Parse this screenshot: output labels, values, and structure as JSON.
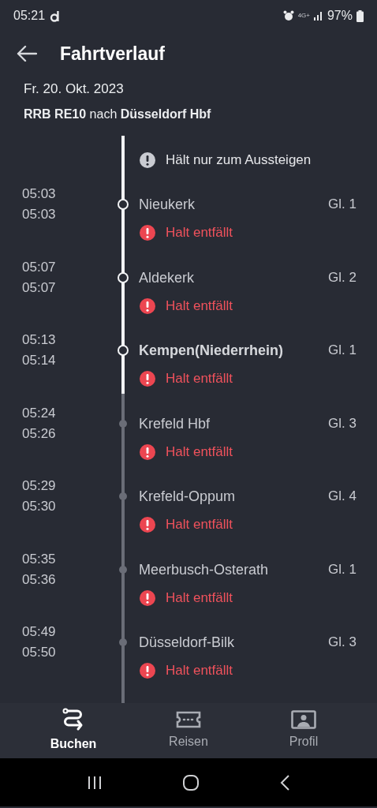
{
  "status_bar": {
    "time": "05:21",
    "network": "4G+",
    "battery": "97%"
  },
  "header": {
    "title": "Fahrtverlauf"
  },
  "trip": {
    "date": "Fr. 20. Okt. 2023",
    "train": "**RRB RE10** nach **Düsseldorf Hbf**"
  },
  "partial_top": {
    "passed": true,
    "notice": {
      "kind": "info",
      "text": "Hält nur zum Aussteigen"
    }
  },
  "stops": [
    {
      "arrival": "05:03",
      "departure": "05:03",
      "name": "Nieukerk",
      "platform": "Gl. 1",
      "passed": true,
      "highlighted": false,
      "notice": {
        "kind": "cancelled",
        "text": "Halt entfällt"
      }
    },
    {
      "arrival": "05:07",
      "departure": "05:07",
      "name": "Aldekerk",
      "platform": "Gl. 2",
      "passed": true,
      "highlighted": false,
      "notice": {
        "kind": "cancelled",
        "text": "Halt entfällt"
      }
    },
    {
      "arrival": "05:13",
      "departure": "05:14",
      "name": "Kempen(Niederrhein)",
      "platform": "Gl. 1",
      "passed": true,
      "highlighted": true,
      "notice": {
        "kind": "cancelled",
        "text": "Halt entfällt"
      }
    },
    {
      "arrival": "05:24",
      "departure": "05:26",
      "name": "Krefeld Hbf",
      "platform": "Gl. 3",
      "passed": false,
      "highlighted": false,
      "notice": {
        "kind": "cancelled",
        "text": "Halt entfällt"
      }
    },
    {
      "arrival": "05:29",
      "departure": "05:30",
      "name": "Krefeld-Oppum",
      "platform": "Gl. 4",
      "passed": false,
      "highlighted": false,
      "notice": {
        "kind": "cancelled",
        "text": "Halt entfällt"
      }
    },
    {
      "arrival": "05:35",
      "departure": "05:36",
      "name": "Meerbusch-Osterath",
      "platform": "Gl. 1",
      "passed": false,
      "highlighted": false,
      "notice": {
        "kind": "cancelled",
        "text": "Halt entfällt"
      }
    },
    {
      "arrival": "05:49",
      "departure": "05:50",
      "name": "Düsseldorf-Bilk",
      "platform": "Gl. 3",
      "passed": false,
      "highlighted": false,
      "notice": {
        "kind": "cancelled",
        "text": "Halt entfällt"
      }
    }
  ],
  "bottom_nav": [
    {
      "kind": "route",
      "label": "Buchen",
      "selected": true
    },
    {
      "kind": "ticket",
      "label": "Reisen",
      "selected": false
    },
    {
      "kind": "profile",
      "label": "Profil",
      "selected": false
    }
  ]
}
